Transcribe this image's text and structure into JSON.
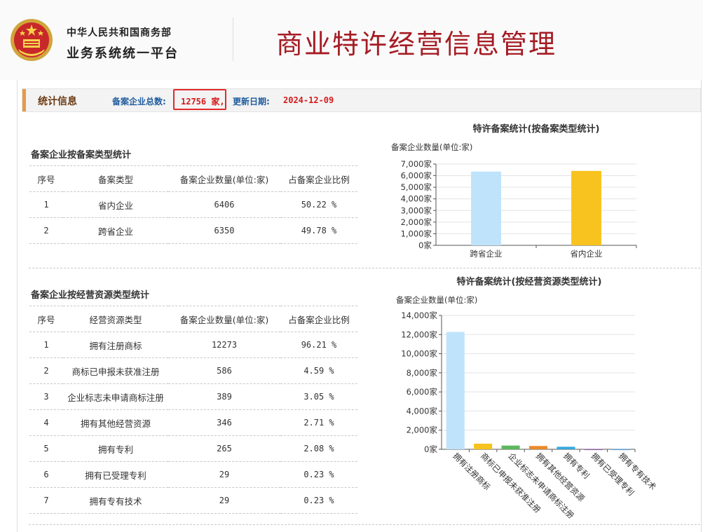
{
  "header": {
    "org_line1": "中华人民共和国商务部",
    "org_line2": "业务系统统一平台",
    "title": "商业特许经营信息管理"
  },
  "stats_bar": {
    "title": "统计信息",
    "total_label": "备案企业总数:",
    "total_value": "12756 家,",
    "update_label": "更新日期:",
    "update_value": "2024-12-09"
  },
  "table1": {
    "title": "备案企业按备案类型统计",
    "headers": [
      "序号",
      "备案类型",
      "备案企业数量(单位:家)",
      "占备案企业比例"
    ],
    "rows": [
      [
        "1",
        "省内企业",
        "6406",
        "50.22 %"
      ],
      [
        "2",
        "跨省企业",
        "6350",
        "49.78 %"
      ]
    ]
  },
  "table2": {
    "title": "备案企业按经营资源类型统计",
    "headers": [
      "序号",
      "经营资源类型",
      "备案企业数量(单位:家)",
      "占备案企业比例"
    ],
    "rows": [
      [
        "1",
        "拥有注册商标",
        "12273",
        "96.21 %"
      ],
      [
        "2",
        "商标已申报未获准注册",
        "586",
        "4.59 %"
      ],
      [
        "3",
        "企业标志未申请商标注册",
        "389",
        "3.05 %"
      ],
      [
        "4",
        "拥有其他经营资源",
        "346",
        "2.71 %"
      ],
      [
        "5",
        "拥有专利",
        "265",
        "2.08 %"
      ],
      [
        "6",
        "拥有已受理专利",
        "29",
        "0.23 %"
      ],
      [
        "7",
        "拥有专有技术",
        "29",
        "0.23 %"
      ]
    ]
  },
  "chart_data": [
    {
      "type": "bar",
      "title": "特许备案统计(按备案类型统计)",
      "ylabel": "备案企业数量(单位:家)",
      "categories": [
        "跨省企业",
        "省内企业"
      ],
      "values": [
        6350,
        6406
      ],
      "colors": [
        "#bfe3fb",
        "#f8c31f"
      ],
      "ylim": [
        0,
        7000
      ],
      "yticks": [
        0,
        1000,
        2000,
        3000,
        4000,
        5000,
        6000,
        7000
      ],
      "ytick_labels": [
        "0家",
        "1,000家",
        "2,000家",
        "3,000家",
        "4,000家",
        "5,000家",
        "6,000家",
        "7,000家"
      ],
      "grid": true
    },
    {
      "type": "bar",
      "title": "特许备案统计(按经营资源类型统计)",
      "ylabel": "备案企业数量(单位:家)",
      "categories": [
        "拥有注册商标",
        "商标已申报未获准注册",
        "企业标志未申请商标注册",
        "拥有其他经营资源",
        "拥有专利",
        "拥有已受理专利",
        "拥有专有技术"
      ],
      "values": [
        12273,
        586,
        389,
        346,
        265,
        29,
        29
      ],
      "colors": [
        "#bfe3fb",
        "#f8c31f",
        "#5cb85c",
        "#e98b2a",
        "#36a9e1",
        "#8e5ea2",
        "#5b9bd5"
      ],
      "ylim": [
        0,
        14000
      ],
      "yticks": [
        0,
        2000,
        4000,
        6000,
        8000,
        10000,
        12000,
        14000
      ],
      "ytick_labels": [
        "0家",
        "2,000家",
        "4,000家",
        "6,000家",
        "8,000家",
        "10,000家",
        "12,000家",
        "14,000家"
      ],
      "grid": true
    }
  ]
}
